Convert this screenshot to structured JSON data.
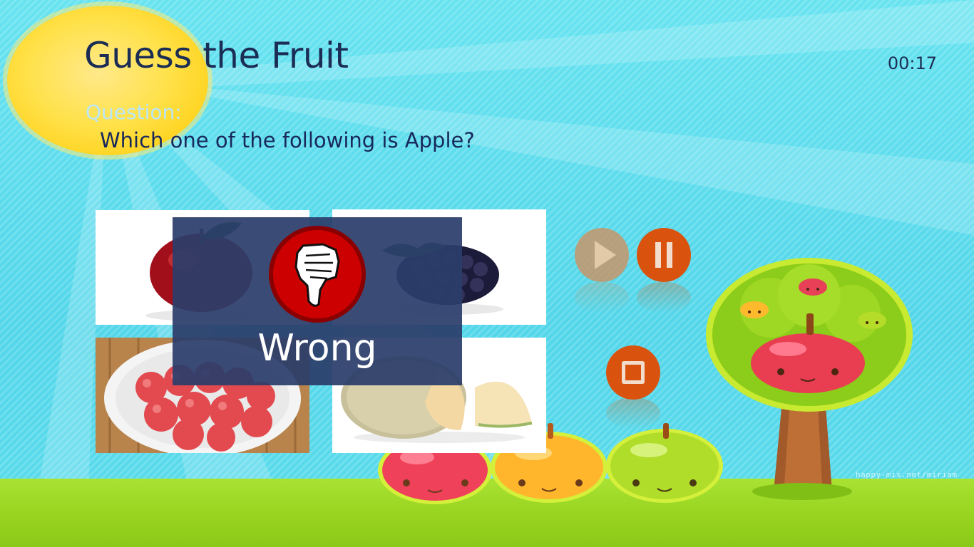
{
  "app": {
    "title": "Guess the Fruit",
    "timer": "00:17"
  },
  "question": {
    "label": "Question:",
    "text": "Which one of the following is Apple?"
  },
  "options": [
    {
      "fruit": "apple"
    },
    {
      "fruit": "blackberry"
    },
    {
      "fruit": "lychee"
    },
    {
      "fruit": "cantaloupe"
    }
  ],
  "feedback": {
    "text": "Wrong",
    "icon": "thumbs-down-icon",
    "color": "#cc0000"
  },
  "controls": [
    {
      "icon": "play-icon",
      "enabled": false
    },
    {
      "icon": "pause-icon",
      "enabled": true
    },
    {
      "icon": "stop-icon",
      "enabled": true
    }
  ],
  "colors": {
    "accent": "#d9530f",
    "title": "#1b2d55",
    "sky": "#5bdcec",
    "grass": "#96d21e"
  },
  "background": {
    "credit": "happy-mix.net/miriam"
  }
}
